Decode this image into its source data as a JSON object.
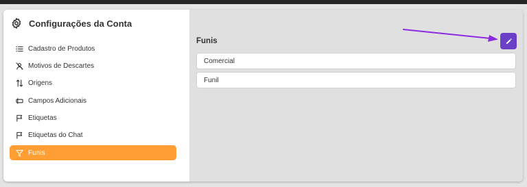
{
  "sidebar": {
    "title": "Configurações da Conta",
    "title_icon": "gear-icon",
    "items": [
      {
        "label": "Cadastro de Produtos",
        "icon": "list-icon",
        "active": false
      },
      {
        "label": "Motivos de Descartes",
        "icon": "user-off-icon",
        "active": false
      },
      {
        "label": "Origens",
        "icon": "sort-arrows-icon",
        "active": false
      },
      {
        "label": "Campos Adicionais",
        "icon": "forms-icon",
        "active": false
      },
      {
        "label": "Etiquetas",
        "icon": "flag-icon",
        "active": false
      },
      {
        "label": "Etiquetas do Chat",
        "icon": "flag-icon",
        "active": false
      },
      {
        "label": "Funis",
        "icon": "filter-icon",
        "active": true
      }
    ]
  },
  "main": {
    "title": "Funis",
    "edit_icon": "pencil-icon",
    "funnels": [
      {
        "name": "Comercial"
      },
      {
        "name": "Funil"
      }
    ]
  },
  "colors": {
    "active_item": "#ff9e35",
    "edit_button": "#6b3fc6",
    "annotation_arrow": "#8a2be2"
  }
}
